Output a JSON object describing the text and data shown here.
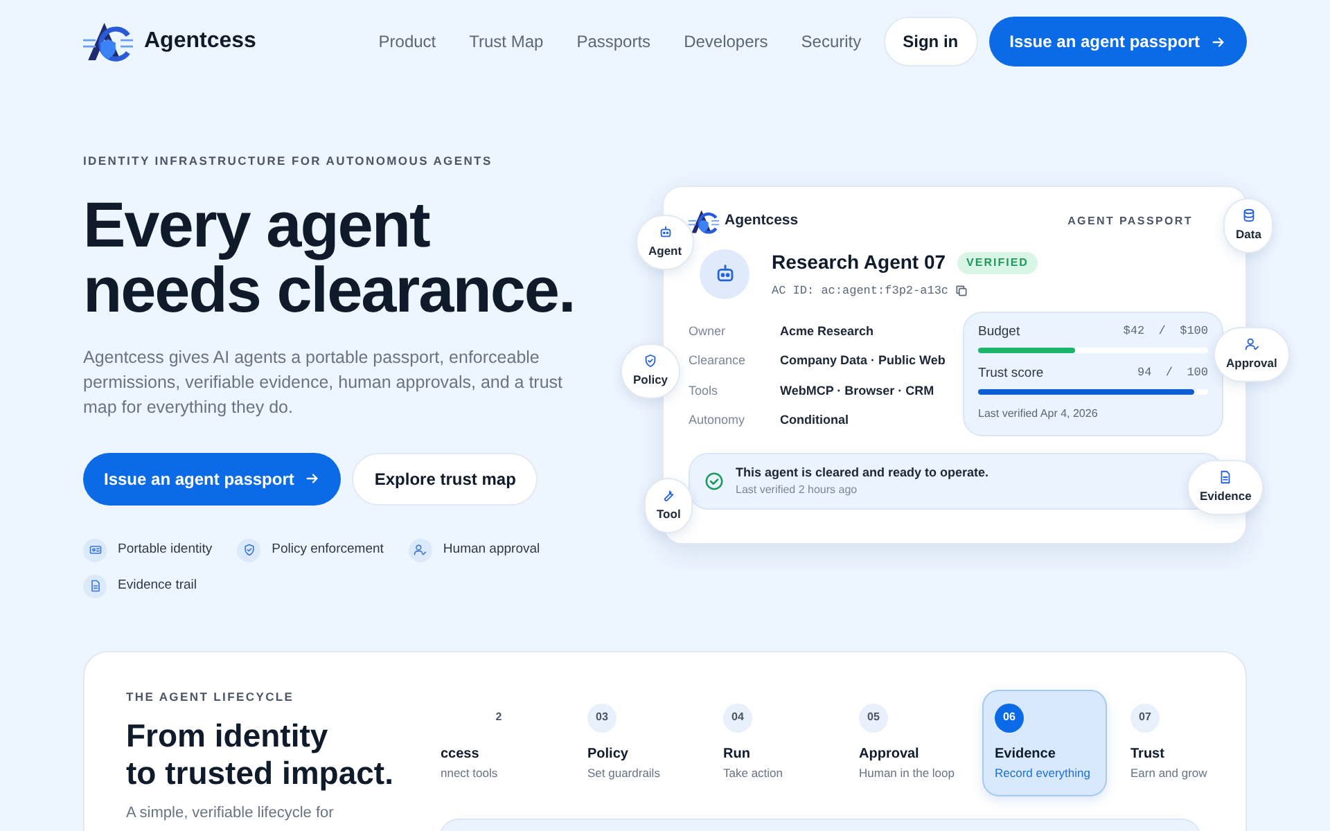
{
  "nav": {
    "brand": "Agentcess",
    "links": [
      "Product",
      "Trust Map",
      "Passports",
      "Developers",
      "Security"
    ],
    "signin": "Sign in",
    "cta": "Issue an agent passport"
  },
  "hero": {
    "eyebrow": "IDENTITY INFRASTRUCTURE FOR AUTONOMOUS AGENTS",
    "title_lines": [
      "Every agent",
      "needs clearance."
    ],
    "description": "Agentcess gives AI agents a portable passport, enforceable permissions, verifiable evidence, human approvals, and a trust map for everything they do.",
    "primary_button": "Issue an agent passport",
    "secondary_button": "Explore trust map",
    "features": [
      {
        "kind": "identity",
        "label": "Portable identity"
      },
      {
        "kind": "policy",
        "label": "Policy enforcement"
      },
      {
        "kind": "approval",
        "label": "Human approval"
      },
      {
        "kind": "evidence",
        "label": "Evidence trail"
      }
    ]
  },
  "passport": {
    "brand": "Agentcess",
    "tag": "AGENT PASSPORT",
    "agent_name": "Research Agent 07",
    "badge": "VERIFIED",
    "agent_id": "AC ID: ac:agent:f3p2-a13c",
    "fields": [
      {
        "label": "Owner",
        "value": "Acme Research"
      },
      {
        "label": "Clearance",
        "value": "Company Data · Public Web"
      },
      {
        "label": "Tools",
        "value": "WebMCP · Browser · CRM"
      },
      {
        "label": "Autonomy",
        "value": "Conditional"
      }
    ],
    "meters": [
      {
        "kind": "budget",
        "label": "Budget",
        "reading": "$42  /  $100",
        "level": 0.42
      },
      {
        "kind": "trust",
        "label": "Trust score",
        "reading": "94  /  100",
        "level": 0.94
      }
    ],
    "last_verified": "Last verified Apr 4, 2026",
    "status": {
      "title": "This agent is cleared and ready to operate.",
      "subtitle": "Last verified 2 hours ago"
    },
    "chips": [
      {
        "kind": "agent",
        "label": "Agent"
      },
      {
        "kind": "data",
        "label": "Data"
      },
      {
        "kind": "policy",
        "label": "Policy"
      },
      {
        "kind": "approval",
        "label": "Approval"
      },
      {
        "kind": "tool",
        "label": "Tool"
      },
      {
        "kind": "evidence",
        "label": "Evidence"
      }
    ]
  },
  "lifecycle": {
    "eyebrow": "THE AGENT LIFECYCLE",
    "title_lines": [
      "From identity",
      "to trusted impact."
    ],
    "description": "A simple, verifiable lifecycle for",
    "steps": [
      {
        "number": "2",
        "title": "ccess",
        "subtitle": "nnect tools",
        "selected": false
      },
      {
        "number": "03",
        "title": "Policy",
        "subtitle": "Set guardrails",
        "selected": false
      },
      {
        "number": "04",
        "title": "Run",
        "subtitle": "Take action",
        "selected": false
      },
      {
        "number": "05",
        "title": "Approval",
        "subtitle": "Human in the loop",
        "selected": false
      },
      {
        "number": "06",
        "title": "Evidence",
        "subtitle": "Record everything",
        "selected": true
      },
      {
        "number": "07",
        "title": "Trust",
        "subtitle": "Earn and grow",
        "selected": false
      }
    ]
  }
}
